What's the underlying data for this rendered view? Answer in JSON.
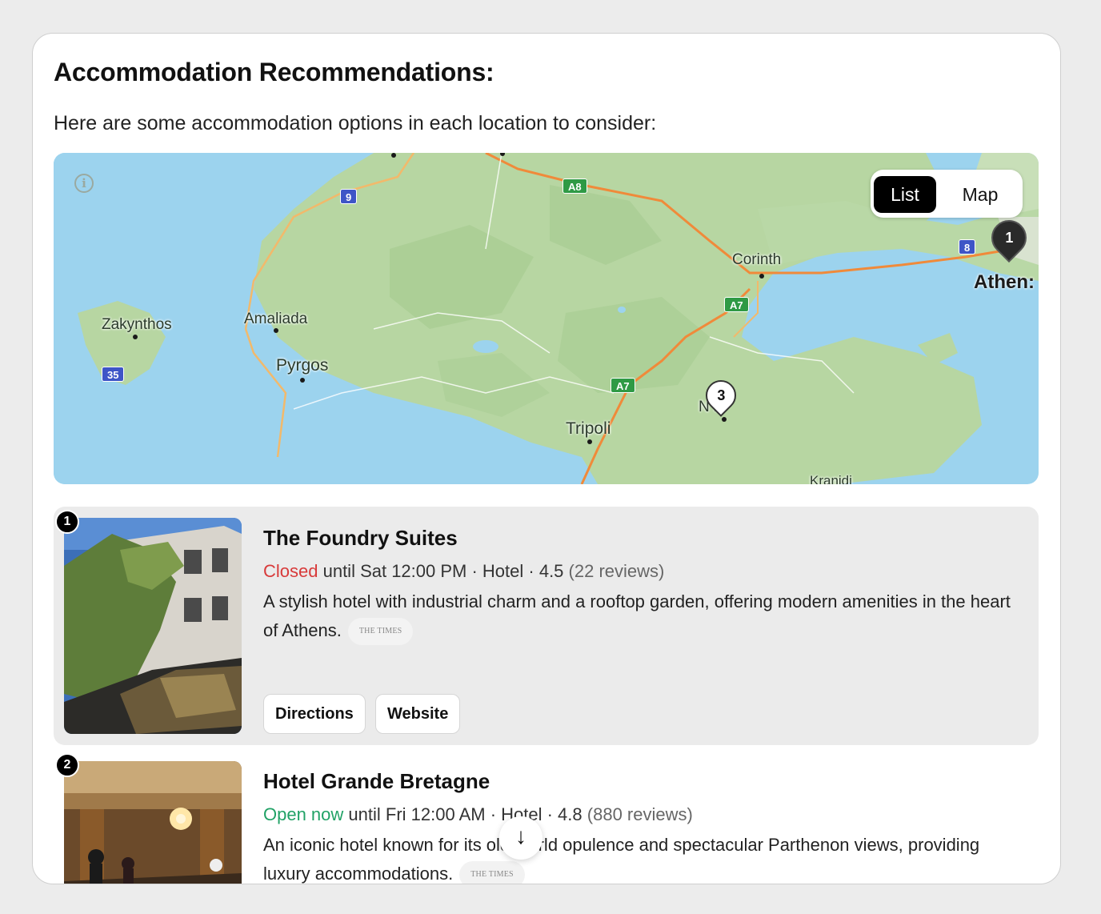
{
  "section": {
    "heading": "Accommodation Recommendations:",
    "intro": "Here are some accommodation options in each location to consider:"
  },
  "map": {
    "view_toggle": {
      "active": "List",
      "inactive": "Map"
    },
    "info_icon": "info-icon",
    "places": {
      "corinth": "Corinth",
      "athens": "Athen:",
      "zakynthos": "Zakynthos",
      "amaliada": "Amaliada",
      "pyrgos": "Pyrgos",
      "tripoli": "Tripoli",
      "nafplio": "N   io",
      "kranidi": "Kranidi"
    },
    "roads": {
      "r9": "9",
      "a8": "A8",
      "r8": "8",
      "a7a": "A7",
      "a7b": "A7",
      "r35": "35"
    },
    "pins": {
      "pin1": "1",
      "pin3": "3"
    },
    "colors": {
      "sea": "#9cd3ee",
      "land": "#b9d8a6",
      "road": "#f2a35c",
      "motorway": "#f08a3a"
    }
  },
  "results": [
    {
      "number": "1",
      "name": "The Foundry Suites",
      "status": "Closed",
      "status_rest": " until Sat 12:00 PM · Hotel · 4.5 ",
      "reviews": "(22 reviews)",
      "description": "A stylish hotel with industrial charm and a rooftop garden, offering modern amenities in the heart of Athens.",
      "source": "THE TIMES",
      "directions": "Directions",
      "website": "Website"
    },
    {
      "number": "2",
      "name": "Hotel Grande Bretagne",
      "status": "Open now",
      "status_rest": " until Fri 12:00 AM · Hotel · 4.8 ",
      "reviews": "(880 reviews)",
      "description": "An iconic hotel known for its old-world opulence and spectacular Parthenon views, providing luxury accommodations.",
      "source": "THE TIMES"
    }
  ],
  "scroll_down_icon": "arrow-down-icon",
  "scroll_glyph": "↓"
}
